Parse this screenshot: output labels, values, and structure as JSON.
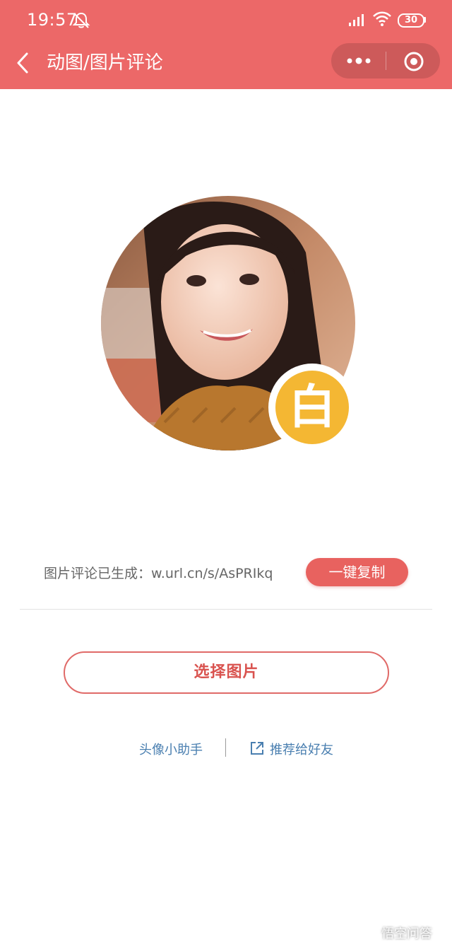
{
  "status_bar": {
    "time": "19:57",
    "battery": "30"
  },
  "nav": {
    "title": "动图/图片评论"
  },
  "badge": {
    "character": "白"
  },
  "link_row": {
    "text": "图片评论已生成：w.url.cn/s/AsPRIkq",
    "copy_label": "一键复制"
  },
  "actions": {
    "choose_label": "选择图片"
  },
  "footer": {
    "helper_label": "头像小助手",
    "recommend_label": "推荐给好友"
  },
  "watermark": {
    "text": "悟空问答"
  },
  "colors": {
    "header": "#ec6868",
    "accent": "#e8625f",
    "link": "#4a7fb0",
    "badge": "#f4b733"
  }
}
